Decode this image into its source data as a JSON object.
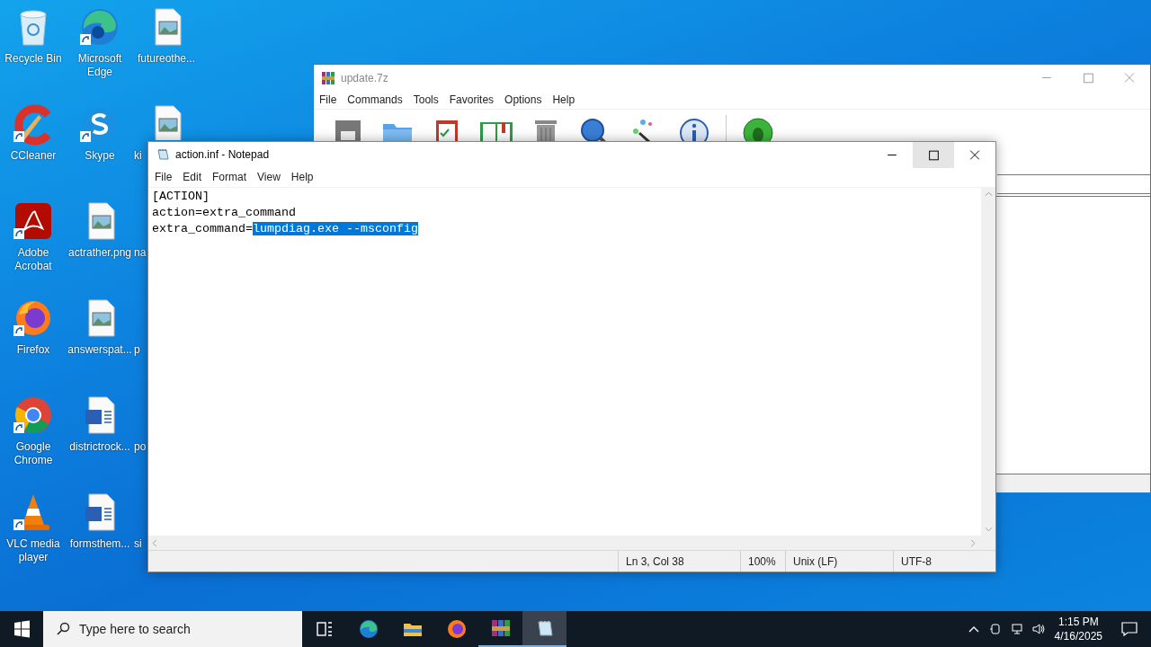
{
  "desktop_icons": [
    {
      "label": "Recycle Bin",
      "kind": "recycle",
      "shortcut": false,
      "partial": false
    },
    {
      "label": "Microsoft Edge",
      "kind": "edge",
      "shortcut": true,
      "partial": false
    },
    {
      "label": "futureothe...",
      "kind": "image",
      "shortcut": false,
      "partial": false
    },
    {
      "label": "CCleaner",
      "kind": "ccleaner",
      "shortcut": true,
      "partial": false
    },
    {
      "label": "Skype",
      "kind": "skype",
      "shortcut": true,
      "partial": false
    },
    {
      "label": "ki",
      "kind": "image",
      "shortcut": false,
      "partial": true
    },
    {
      "label": "Adobe Acrobat",
      "kind": "acrobat",
      "shortcut": true,
      "partial": false
    },
    {
      "label": "actrather.png",
      "kind": "image",
      "shortcut": false,
      "partial": false
    },
    {
      "label": "na",
      "kind": "hidden",
      "partial": true
    },
    {
      "label": "Firefox",
      "kind": "firefox",
      "shortcut": true,
      "partial": false
    },
    {
      "label": "answerspat...",
      "kind": "image",
      "shortcut": false,
      "partial": false
    },
    {
      "label": "p",
      "kind": "hidden",
      "partial": true
    },
    {
      "label": "Google Chrome",
      "kind": "chrome",
      "shortcut": true,
      "partial": false
    },
    {
      "label": "districtrock...",
      "kind": "word",
      "shortcut": false,
      "partial": false
    },
    {
      "label": "po",
      "kind": "hidden",
      "partial": true
    },
    {
      "label": "VLC media player",
      "kind": "vlc",
      "shortcut": true,
      "partial": false
    },
    {
      "label": "formsthem...",
      "kind": "word",
      "shortcut": false,
      "partial": false
    },
    {
      "label": "si",
      "kind": "hidden",
      "partial": true
    }
  ],
  "archive_window": {
    "title": "update.7z",
    "menu": [
      "File",
      "Commands",
      "Tools",
      "Favorites",
      "Options",
      "Help"
    ]
  },
  "notepad": {
    "title": "action.inf - Notepad",
    "menu": [
      "File",
      "Edit",
      "Format",
      "View",
      "Help"
    ],
    "lines": [
      {
        "text": "[ACTION]"
      },
      {
        "text": "action=extra_command"
      },
      {
        "text": "extra_command=",
        "selected_text": "lumpdiag.exe --msconfig"
      }
    ],
    "status": [
      "Ln 3, Col 38",
      "100%",
      "Unix (LF)",
      "UTF-8"
    ]
  },
  "taskbar": {
    "search": {
      "placeholder": "Type here to search"
    },
    "apps": [
      {
        "kind": "taskview",
        "running": false,
        "selected": false
      },
      {
        "kind": "edge",
        "running": false,
        "selected": false
      },
      {
        "kind": "folder",
        "running": false,
        "selected": false
      },
      {
        "kind": "firefox",
        "running": false,
        "selected": false
      },
      {
        "kind": "winrar",
        "running": true,
        "selected": false
      },
      {
        "kind": "notepad",
        "running": true,
        "selected": true
      }
    ],
    "time": "1:15 PM",
    "date": "4/16/2025"
  }
}
